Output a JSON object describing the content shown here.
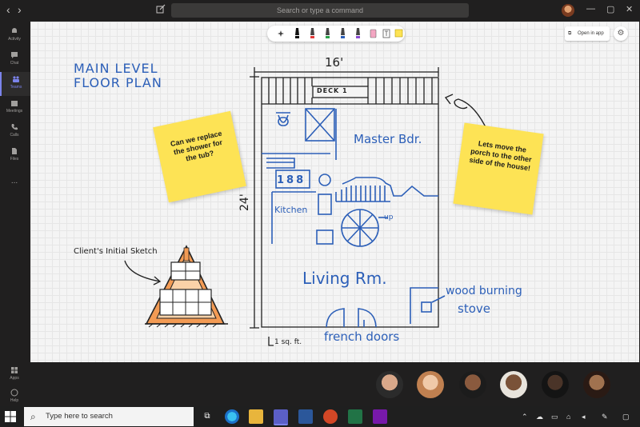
{
  "window": {
    "search_placeholder": "Search or type a command",
    "back_symbol": "‹",
    "forward_symbol": "›",
    "minimize_symbol": "—",
    "maximize_symbol": "▢",
    "close_symbol": "✕"
  },
  "rail": {
    "items": [
      {
        "label": "Activity",
        "icon": "bell-icon"
      },
      {
        "label": "Chat",
        "icon": "chat-icon"
      },
      {
        "label": "Teams",
        "icon": "teams-icon"
      },
      {
        "label": "Meetings",
        "icon": "calendar-icon"
      },
      {
        "label": "Calls",
        "icon": "phone-icon"
      },
      {
        "label": "Files",
        "icon": "file-icon"
      },
      {
        "label": "...",
        "icon": "more-icon"
      }
    ],
    "bottom": [
      {
        "label": "Apps",
        "icon": "apps-icon"
      },
      {
        "label": "Help",
        "icon": "help-icon"
      }
    ]
  },
  "whiteboard": {
    "open_in_app": "Open in app",
    "toolbar_tools": [
      "lasso",
      "black-pen",
      "red-pen",
      "green-pen",
      "blue-pen",
      "purple-pen",
      "eraser",
      "text",
      "note"
    ],
    "title_line1": "MAIN LEVEL",
    "title_line2": "FLOOR PLAN",
    "width_label": "16'",
    "height_label": "24'",
    "deck_label": "DECK 1",
    "master_label": "Master Bdr.",
    "kitchen_label": "Kitchen",
    "up_label": "up",
    "living_label": "Living Rm.",
    "stove_label_1": "wood burning",
    "stove_label_2": "stove",
    "scale_label": "1 sq. ft.",
    "doors_label": "french doors",
    "sketch_label": "Client's Initial Sketch",
    "note_left": "Can we replace the shower for the tub?",
    "note_right": "Lets move the porch to the other side of the house!"
  },
  "participants": [
    {
      "name": "participant-1",
      "color": "#c59a7a"
    },
    {
      "name": "participant-2",
      "color": "#e5b894"
    },
    {
      "name": "participant-3",
      "color": "#8a5a3e"
    },
    {
      "name": "participant-4",
      "color": "#6b4a35"
    },
    {
      "name": "participant-5",
      "color": "#3a2a22"
    },
    {
      "name": "participant-6",
      "color": "#a0724f"
    }
  ],
  "taskbar": {
    "search_placeholder": "Type here to search",
    "apps": [
      "task-view",
      "edge",
      "file-explorer",
      "teams",
      "word",
      "powerpoint",
      "excel",
      "onenote"
    ]
  },
  "colors": {
    "accent": "#7b83eb",
    "note_yellow": "#fde355",
    "ink_blue": "#2c5fb8",
    "triangle_orange": "#f39b54"
  }
}
